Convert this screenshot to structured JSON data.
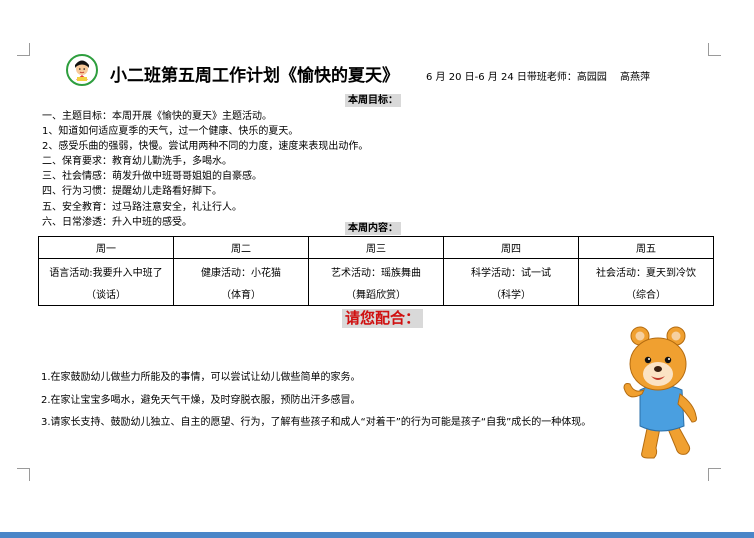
{
  "header": {
    "title": "小二班第五周工作计划《愉快的夏天》",
    "date_teacher": "6 月 20 日-6 月 24 日带班老师：高园园　 高燕萍"
  },
  "goals": {
    "heading": "本周目标：",
    "lines": [
      "一、主题目标：本周开展《愉快的夏天》主题活动。",
      "1、知道如何适应夏季的天气，过一个健康、快乐的夏天。",
      "2、感受乐曲的强弱，快慢。尝试用两种不同的力度，速度来表现出动作。",
      "二、保育要求：教育幼儿勤洗手，多喝水。",
      "三、社会情感：萌发升做中班哥哥姐姐的自豪感。",
      "四、行为习惯：提醒幼儿走路看好脚下。",
      "五、安全教育：过马路注意安全，礼让行人。",
      "六、日常渗透：升入中班的感受。"
    ]
  },
  "content": {
    "heading": "本周内容：",
    "columns": [
      {
        "day": "周一",
        "activity": "语言活动:我要升入中班了",
        "category": "（谈话）"
      },
      {
        "day": "周二",
        "activity": "健康活动：小花猫",
        "category": "（体育）"
      },
      {
        "day": "周三",
        "activity": "艺术活动：瑶族舞曲",
        "category": "（舞蹈欣赏）"
      },
      {
        "day": "周四",
        "activity": "科学活动：试一试",
        "category": "（科学）"
      },
      {
        "day": "周五",
        "activity": "社会活动：夏天到冷饮",
        "category": "（综合）"
      }
    ]
  },
  "cooperation": {
    "heading": "请您配合：",
    "notes": [
      "1.在家鼓励幼儿做些力所能及的事情，可以尝试让幼儿做些简单的家务。",
      "2.在家让宝宝多喝水，避免天气干燥，及时穿脱衣服，预防出汗多感冒。",
      "3.请家长支持、鼓励幼儿独立、自主的愿望、行为，了解有些孩子和成人“对着干”的行为可能是孩子“自我”成长的一种体现。"
    ]
  },
  "colors": {
    "accent_red": "#d01010",
    "heading_bg": "#d9d9d9",
    "bear_body": "#f0a030",
    "bear_shirt": "#4a9fe0"
  }
}
